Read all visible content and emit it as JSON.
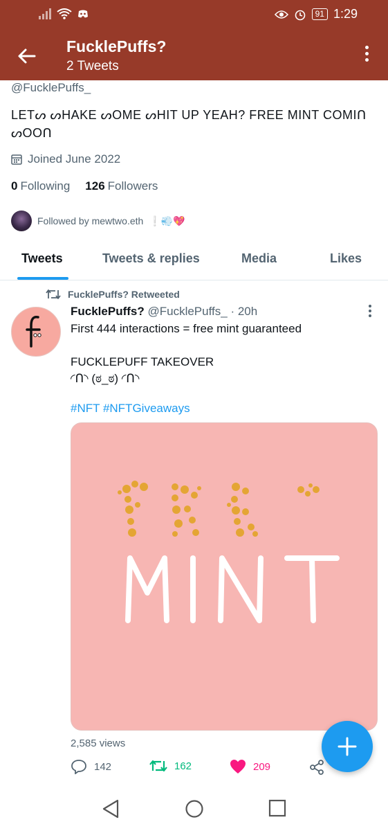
{
  "status_bar": {
    "battery": "91",
    "time": "1:29",
    "icons": [
      "signal-icon",
      "wifi-icon",
      "discord-icon",
      "eye-icon",
      "alarm-icon",
      "battery-icon"
    ]
  },
  "header": {
    "title": "FucklePuffs?",
    "subtitle": "2 Tweets"
  },
  "profile": {
    "handle": "@FucklePuffs_",
    "bio": "LETᔕ ᔕHAKE ᔕOME ᔕHIT UP YEAH? FREE MINT COMIᑎ ᔕOOᑎ",
    "joined": "Joined June 2022",
    "following_count": "0",
    "following_label": "Following",
    "followers_count": "126",
    "followers_label": "Followers",
    "followed_by": "Followed by mewtwo.eth",
    "followed_by_emoji": "❕💨💖"
  },
  "tabs": [
    "Tweets",
    "Tweets & replies",
    "Media",
    "Likes"
  ],
  "active_tab": "Tweets",
  "tweet": {
    "retweet_label": "FucklePuffs? Retweeted",
    "author_name": "FucklePuffs?",
    "author_handle": "@FucklePuffs_",
    "time_sep": "·",
    "time": "20h",
    "avatar_letter": "f",
    "text": "First 444 interactions = free mint guaranteed\n\nFUCKLEPUFF TAKEOVER\n◜ᑎ◝ (ಠ_ಠ) ◜ᑎ◝",
    "hashtag_1": "#NFT",
    "hashtag_2": "#NFTGiveaways",
    "media_text_top": "FREE",
    "media_text_bottom": "MINT",
    "views": "2,585 views",
    "replies": "142",
    "retweets": "162",
    "likes": "209"
  },
  "colors": {
    "header_bg": "#973a29",
    "accent": "#1d9bf0",
    "retweet_green": "#00ba7c",
    "like_pink": "#f91880",
    "media_bg": "#f7b6b3"
  }
}
